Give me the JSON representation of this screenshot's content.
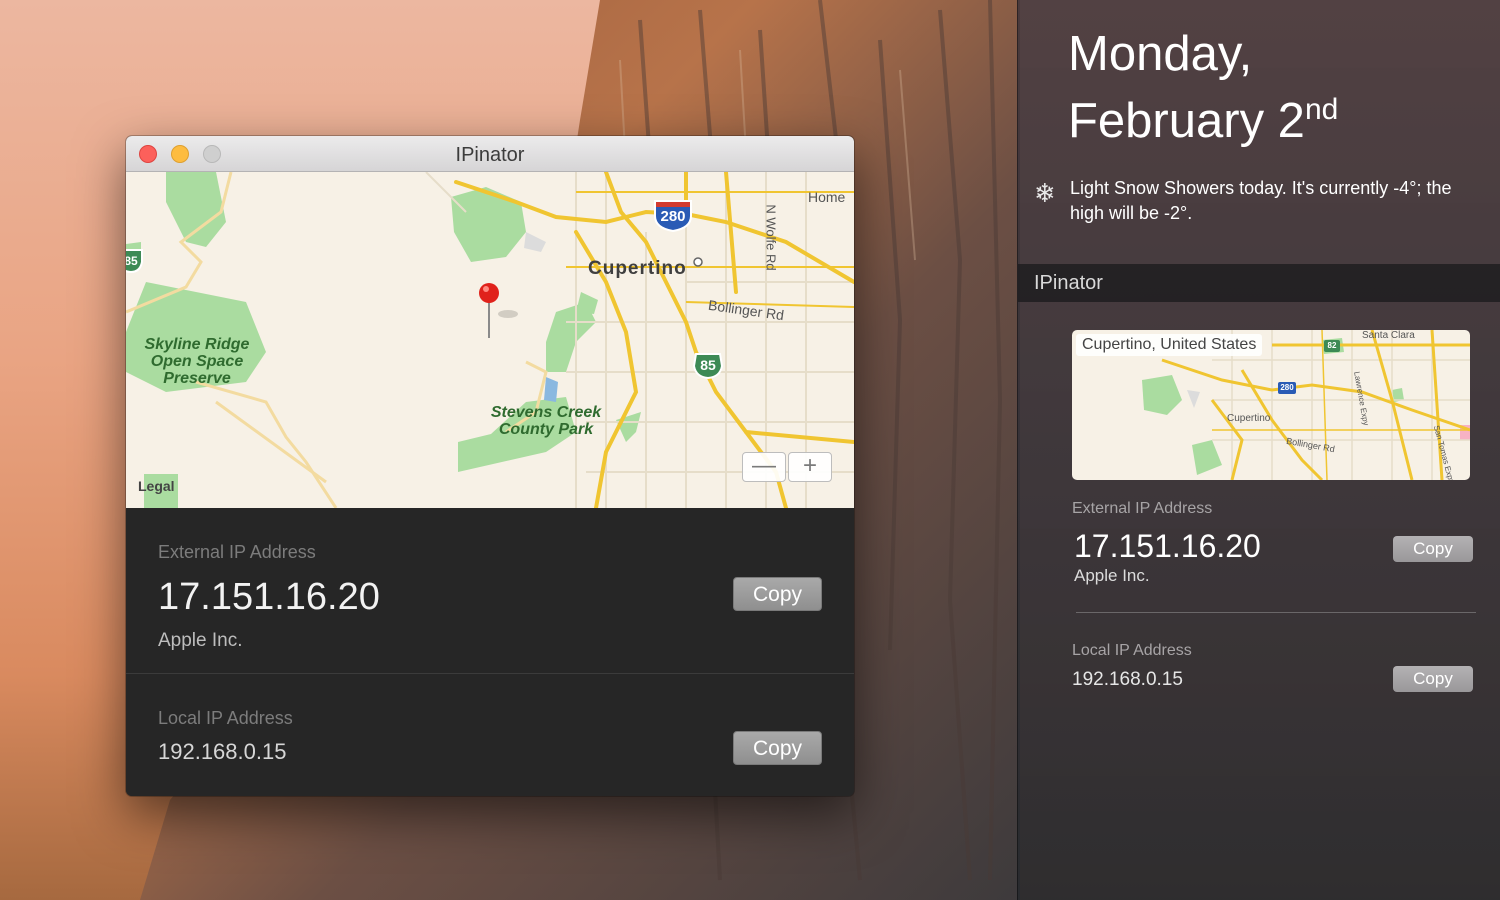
{
  "window": {
    "title": "IPinator"
  },
  "map": {
    "labels": {
      "cupertino": "Cupertino",
      "home": "Home",
      "bollinger": "Bollinger Rd",
      "wolfe": "N Wolfe Rd",
      "skyline": "Skyline Ridge Open Space Preserve",
      "stevens": "Stevens Creek County Park",
      "legal": "Legal"
    },
    "shields": {
      "interstate": "280",
      "state": "85",
      "state_edge": "85"
    },
    "zoom_out": "—",
    "zoom_in": "+"
  },
  "external": {
    "label": "External IP Address",
    "ip": "17.151.16.20",
    "org": "Apple Inc.",
    "copy_label": "Copy"
  },
  "local": {
    "label": "Local IP Address",
    "ip": "192.168.0.15",
    "copy_label": "Copy"
  },
  "notification_center": {
    "date_line1": "Monday,",
    "date_line2": "February 2",
    "date_suffix": "nd",
    "weather_icon": "snowflake-icon",
    "weather": "Light Snow Showers today. It's currently -4°; the high will be -2°.",
    "widget_title": "IPinator",
    "map_caption": "Cupertino, United States",
    "map_labels": {
      "santa_clara": "Santa Clara",
      "cupertino": "Cupertino",
      "bollinger": "Bollinger Rd",
      "lawrence": "Lawrence Expy",
      "san_tomas": "San Tomas Expy",
      "shield_280": "280",
      "shield_82": "82"
    },
    "external": {
      "label": "External IP Address",
      "ip": "17.151.16.20",
      "org": "Apple Inc.",
      "copy_label": "Copy"
    },
    "local": {
      "label": "Local IP Address",
      "ip": "192.168.0.15",
      "copy_label": "Copy"
    }
  },
  "colors": {
    "pin": "#e0221b",
    "road": "#f0c531",
    "park": "#aadca0",
    "interstate": "#2a5bb5"
  }
}
